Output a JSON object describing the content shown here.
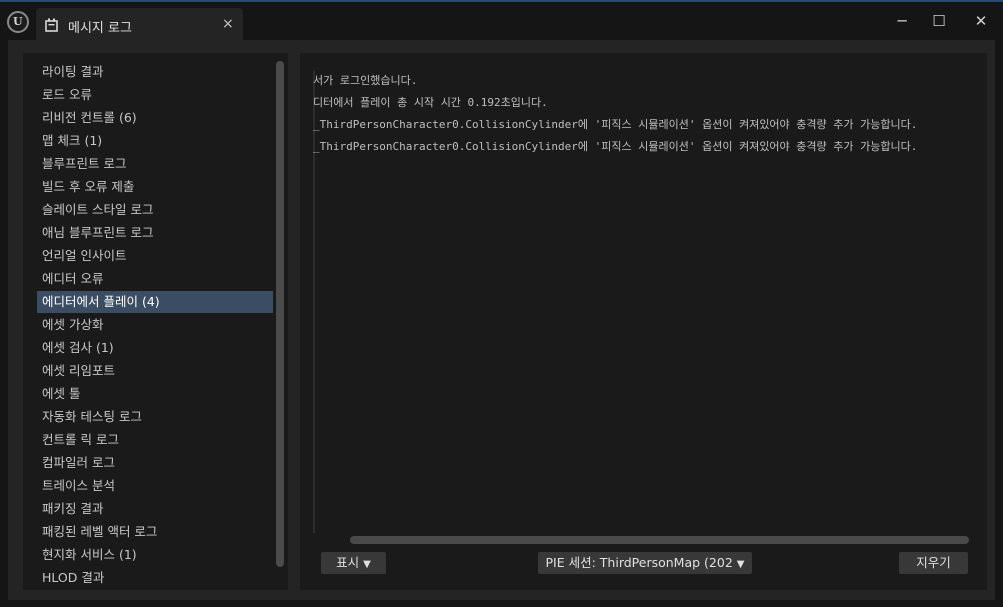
{
  "window": {
    "tab_title": "메시지 로그",
    "tab_close": "×",
    "minimize": "─",
    "maximize": "☐",
    "close": "✕"
  },
  "categories": [
    "라이팅 결과",
    "로드 오류",
    "리비전 컨트롤 (6)",
    "맵 체크 (1)",
    "블루프린트 로그",
    "빌드 후 오류 제출",
    "슬레이트 스타일 로그",
    "애님 블루프린트 로그",
    "언리얼 인사이트",
    "에디터 오류",
    "에디터에서 플레이 (4)",
    "에셋 가상화",
    "에셋 검사 (1)",
    "에셋 리임포트",
    "에셋 툴",
    "자동화 테스팅 로그",
    "컨트롤 릭 로그",
    "컴파일러 로그",
    "트레이스 분석",
    "패키징 결과",
    "패킹된 레벨 액터 로그",
    "현지화 서비스 (1)",
    "HLOD 결과"
  ],
  "selected_category": "에디터에서 플레이 (4)",
  "log_lines": [
    "서가 로그인했습니다.",
    "디터에서 플레이 총 시작 시간 0.192초입니다.",
    "_ThirdPersonCharacter0.CollisionCylinder에 '피직스 시뮬레이션' 옵션이 켜져있어야 충격량 추가 가능합니다.",
    "_ThirdPersonCharacter0.CollisionCylinder에 '피직스 시뮬레이션' 옵션이 켜져있어야 충격량 추가 가능합니다."
  ],
  "toolbar": {
    "show_label": "표시",
    "pie_session_label": "PIE 세션: ThirdPersonMap (202",
    "clear_label": "지우기"
  },
  "colors": {
    "selection": "#3b4d63",
    "panel": "#1a1a1a",
    "window": "#242424",
    "titlebar_accent": "#2b4a73"
  }
}
